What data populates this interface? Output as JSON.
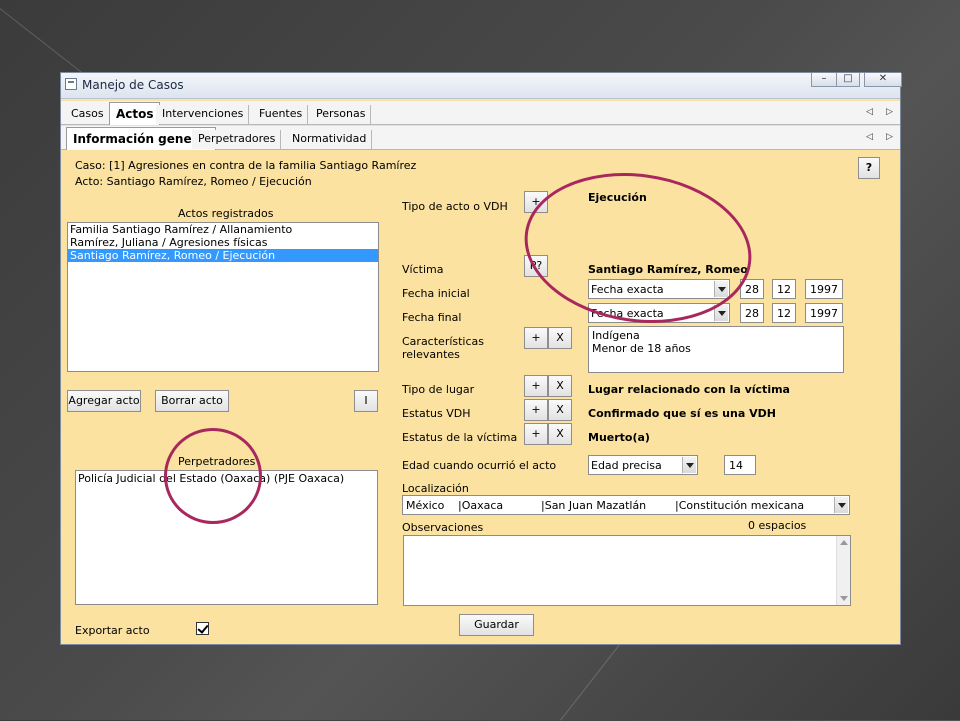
{
  "window": {
    "title": "Manejo de Casos"
  },
  "main_tabs": [
    {
      "label": "Casos"
    },
    {
      "label": "Actos"
    },
    {
      "label": "Intervenciones"
    },
    {
      "label": "Fuentes"
    },
    {
      "label": "Personas"
    }
  ],
  "sub_tabs": [
    {
      "label": "Información general"
    },
    {
      "label": "Perpetradores"
    },
    {
      "label": "Normatividad"
    }
  ],
  "header": {
    "caso": "Caso: [1] Agresiones en contra de la familia Santiago Ramírez",
    "acto": "Acto: Santiago Ramírez, Romeo / Ejecución",
    "help_label": "?"
  },
  "actos": {
    "heading": "Actos registrados",
    "items": [
      "Familia Santiago Ramírez / Allanamiento",
      "Ramírez, Juliana / Agresiones físicas",
      "Santiago Ramírez, Romeo / Ejecución"
    ],
    "add_label": "Agregar acto",
    "delete_label": "Borrar acto",
    "i_label": "I"
  },
  "perpetradores": {
    "heading": "Perpetradores",
    "items": [
      "Policía Judicial del Estado (Oaxaca) (PJE Oaxaca)"
    ]
  },
  "form": {
    "tipo_acto_label": "Tipo de acto o VDH",
    "tipo_acto_value": "Ejecución",
    "victima_label": "Víctima",
    "victima_value": "Santiago Ramírez, Romeo",
    "victima_btn": "P?",
    "fecha_inicial_label": "Fecha inicial",
    "fecha_inicial": {
      "type": "Fecha exacta",
      "day": "28",
      "month": "12",
      "year": "1997"
    },
    "fecha_final_label": "Fecha final",
    "fecha_final": {
      "type": "Fecha exacta",
      "day": "28",
      "month": "12",
      "year": "1997"
    },
    "caracteristicas_label_1": "Características",
    "caracteristicas_label_2": "relevantes",
    "caracteristicas": [
      "Indígena",
      "Menor de 18 años"
    ],
    "tipo_lugar_label": "Tipo de lugar",
    "tipo_lugar_value": "Lugar relacionado con la víctima",
    "estatus_vdh_label": "Estatus VDH",
    "estatus_vdh_value": "Confirmado que sí es una VDH",
    "estatus_victima_label": "Estatus de la víctima",
    "estatus_victima_value": "Muerto(a)",
    "edad_label": "Edad cuando ocurrió el acto",
    "edad_tipo": "Edad precisa",
    "edad_valor": "14",
    "localizacion_label": "Localización",
    "localizacion": [
      "México",
      "|Oaxaca",
      "|San Juan Mazatlán",
      "|Constitución mexicana"
    ],
    "observaciones_label": "Observaciones",
    "espacios": "0 espacios",
    "plus": "+",
    "x": "X"
  },
  "footer": {
    "exportar_label": "Exportar acto",
    "exportar_checked": true,
    "guardar_label": "Guardar"
  },
  "colors": {
    "panel": "#fbe2a0",
    "selection": "#3399ff",
    "annotation": "#a8285e"
  }
}
